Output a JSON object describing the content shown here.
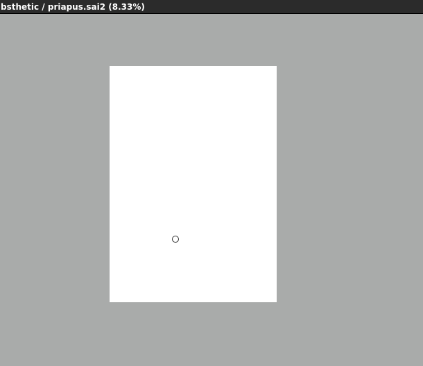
{
  "window": {
    "title": "bsthetic / priapus.sai2 (8.33%)"
  },
  "colors": {
    "titlebar": "#2b2b2b",
    "workspace": "#a9abaa",
    "canvas": "#ffffff"
  },
  "icons": {
    "cursor": "brush-circle-cursor"
  }
}
